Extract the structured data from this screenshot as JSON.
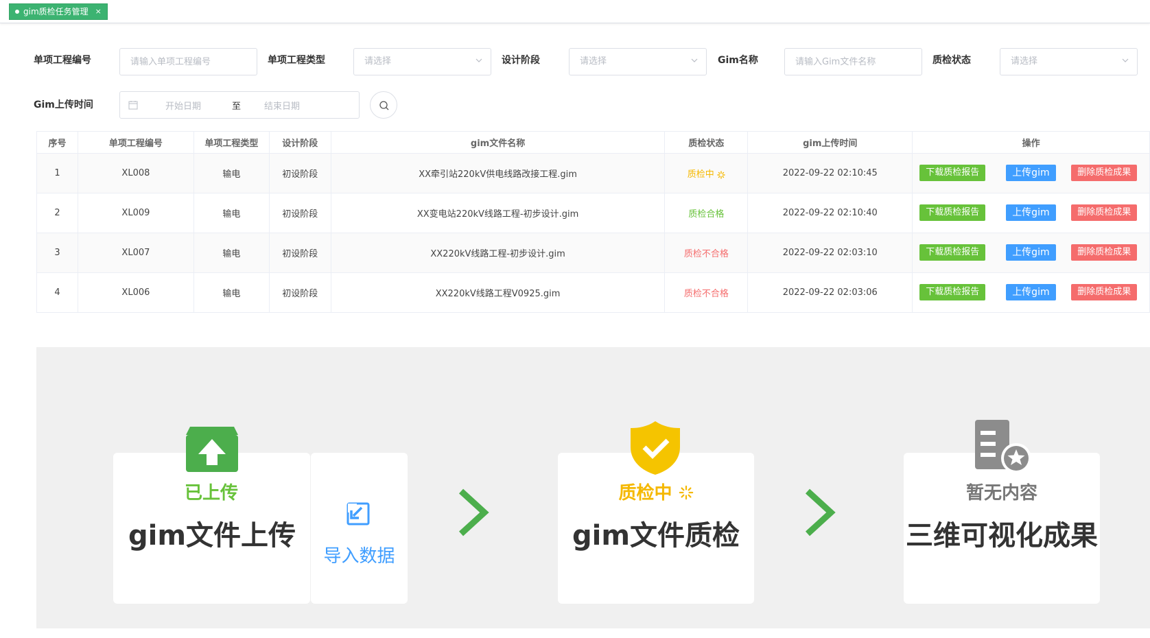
{
  "tab": {
    "label": "gim质检任务管理",
    "close": "×"
  },
  "filters": {
    "project_no_label": "单项工程编号",
    "project_no_placeholder": "请输入单项工程编号",
    "project_type_label": "单项工程类型",
    "project_type_placeholder": "请选择",
    "design_stage_label": "设计阶段",
    "design_stage_placeholder": "请选择",
    "gim_name_label": "Gim名称",
    "gim_name_placeholder": "请输入Gim文件名称",
    "qc_status_label": "质检状态",
    "qc_status_placeholder": "请选择",
    "upload_time_label": "Gim上传时间",
    "start_date": "开始日期",
    "date_sep": "至",
    "end_date": "结束日期"
  },
  "table": {
    "headers": [
      "序号",
      "单项工程编号",
      "单项工程类型",
      "设计阶段",
      "gim文件名称",
      "质检状态",
      "gim上传时间",
      "操作"
    ],
    "rows": [
      {
        "no": "1",
        "code": "XL008",
        "type": "输电",
        "stage": "初设阶段",
        "file": "XX牵引站220kV供电线路改接工程.gim",
        "status": "质检中",
        "time": "2022-09-22 02:10:45"
      },
      {
        "no": "2",
        "code": "XL009",
        "type": "输电",
        "stage": "初设阶段",
        "file": "XX变电站220kV线路工程-初步设计.gim",
        "status": "质检合格",
        "time": "2022-09-22 02:10:40"
      },
      {
        "no": "3",
        "code": "XL007",
        "type": "输电",
        "stage": "初设阶段",
        "file": "XX220kV线路工程-初步设计.gim",
        "status": "质检不合格",
        "time": "2022-09-22 02:03:10"
      },
      {
        "no": "4",
        "code": "XL006",
        "type": "输电",
        "stage": "初设阶段",
        "file": "XX220kV线路工程V0925.gim",
        "status": "质检不合格",
        "time": "2022-09-22 02:03:06"
      }
    ],
    "actions": {
      "download": "下载质检报告",
      "upload": "上传gim",
      "delete": "删除质检成果"
    }
  },
  "flow": {
    "step1_status": "已上传",
    "step1_title": "gim文件上传",
    "import_label": "导入数据",
    "step2_status": "质检中",
    "step2_title": "gim文件质检",
    "step3_status": "暂无内容",
    "step3_title": "三维可视化成果"
  },
  "colors": {
    "accent_green": "#3cb371",
    "ok_green": "#67c23a",
    "blue": "#409eff",
    "red": "#f56c6c",
    "yellow": "#f5b800",
    "gray_icon": "#8c8c8c"
  },
  "icons": [
    "calendar-icon",
    "search-icon",
    "chevron-down-icon",
    "upload-box-icon",
    "import-icon",
    "shield-check-icon",
    "spinner-icon",
    "document-star-icon",
    "chevron-right-icon"
  ]
}
